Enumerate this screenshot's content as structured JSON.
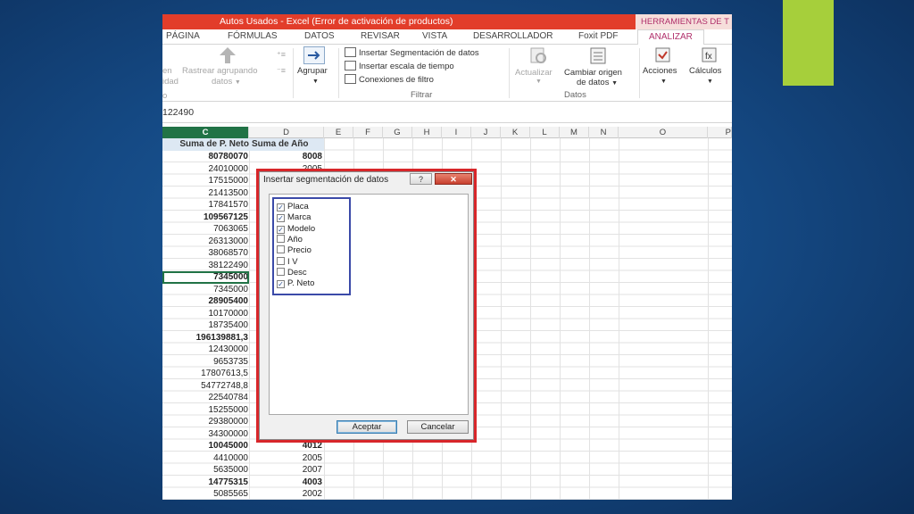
{
  "window": {
    "title": "Autos Usados -  Excel (Error de activación de productos)",
    "context_tab": "HERRAMIENTAS DE T"
  },
  "tabs": [
    "PÁGINA",
    "FÓRMULAS",
    "DATOS",
    "REVISAR",
    "VISTA",
    "DESARROLLADOR",
    "Foxit PDF",
    "ANALIZAR"
  ],
  "ribbon": {
    "partial_left": "en",
    "partial_left2": "idad",
    "partial_left3": "o",
    "rastrear_label": "Rastrear agrupando",
    "rastrear_sub": "datos",
    "agrupar_label": "Agrupar",
    "insert_slicer": "Insertar Segmentación de datos",
    "insert_timeline": "Insertar escala de tiempo",
    "filter_connections": "Conexiones de filtro",
    "group_filtrar": "Filtrar",
    "actualizar": "Actualizar",
    "cambiar_origen": "Cambiar origen",
    "cambiar_origen2": "de datos",
    "group_datos": "Datos",
    "acciones": "Acciones",
    "calculos": "Cálculos"
  },
  "formula_bar": {
    "value": "122490"
  },
  "columns": [
    "C",
    "D",
    "E",
    "F",
    "G",
    "H",
    "I",
    "J",
    "K",
    "L",
    "M",
    "N",
    "O",
    "P"
  ],
  "table": {
    "headers": {
      "c": "Suma de P. Neto",
      "d": "Suma de Año"
    },
    "rows": [
      {
        "c": "80780070",
        "d": "8008",
        "bold": true
      },
      {
        "c": "24010000",
        "d": "2005",
        "bold": false
      },
      {
        "c": "17515000",
        "d": "",
        "bold": false
      },
      {
        "c": "21413500",
        "d": "",
        "bold": false
      },
      {
        "c": "17841570",
        "d": "",
        "bold": false
      },
      {
        "c": "109567125",
        "d": "",
        "bold": true
      },
      {
        "c": "7063065",
        "d": "",
        "bold": false
      },
      {
        "c": "26313000",
        "d": "",
        "bold": false
      },
      {
        "c": "38068570",
        "d": "",
        "bold": false
      },
      {
        "c": "38122490",
        "d": "",
        "bold": false
      },
      {
        "c": "7345000",
        "d": "",
        "bold": true
      },
      {
        "c": "7345000",
        "d": "",
        "bold": false
      },
      {
        "c": "28905400",
        "d": "",
        "bold": true
      },
      {
        "c": "10170000",
        "d": "",
        "bold": false
      },
      {
        "c": "18735400",
        "d": "",
        "bold": false
      },
      {
        "c": "196139881,3",
        "d": "",
        "bold": true
      },
      {
        "c": "12430000",
        "d": "",
        "bold": false
      },
      {
        "c": "9653735",
        "d": "",
        "bold": false
      },
      {
        "c": "17807613,5",
        "d": "",
        "bold": false
      },
      {
        "c": "54772748,8",
        "d": "",
        "bold": false
      },
      {
        "c": "22540784",
        "d": "",
        "bold": false
      },
      {
        "c": "15255000",
        "d": "",
        "bold": false
      },
      {
        "c": "29380000",
        "d": "",
        "bold": false
      },
      {
        "c": "34300000",
        "d": "",
        "bold": false
      },
      {
        "c": "10045000",
        "d": "4012",
        "bold": true
      },
      {
        "c": "4410000",
        "d": "2005",
        "bold": false
      },
      {
        "c": "5635000",
        "d": "2007",
        "bold": false
      },
      {
        "c": "14775315",
        "d": "4003",
        "bold": true
      },
      {
        "c": "5085565",
        "d": "2002",
        "bold": false
      }
    ]
  },
  "dialog": {
    "title": "Insertar segmentación de datos",
    "help": "?",
    "close": "✕",
    "options": [
      {
        "label": "Placa",
        "checked": true
      },
      {
        "label": "Marca",
        "checked": true
      },
      {
        "label": "Modelo",
        "checked": true
      },
      {
        "label": "Año",
        "checked": false
      },
      {
        "label": "Precio",
        "checked": false
      },
      {
        "label": "I V",
        "checked": false
      },
      {
        "label": "Desc",
        "checked": false
      },
      {
        "label": "P. Neto",
        "checked": true
      }
    ],
    "ok": "Aceptar",
    "cancel": "Cancelar"
  },
  "colors": {
    "excel_green": "#217346",
    "title_red": "#e23d2a",
    "highlight_red": "#d8262a",
    "highlight_blue": "#3b4aa8",
    "accent_green": "#a6cf3b"
  }
}
